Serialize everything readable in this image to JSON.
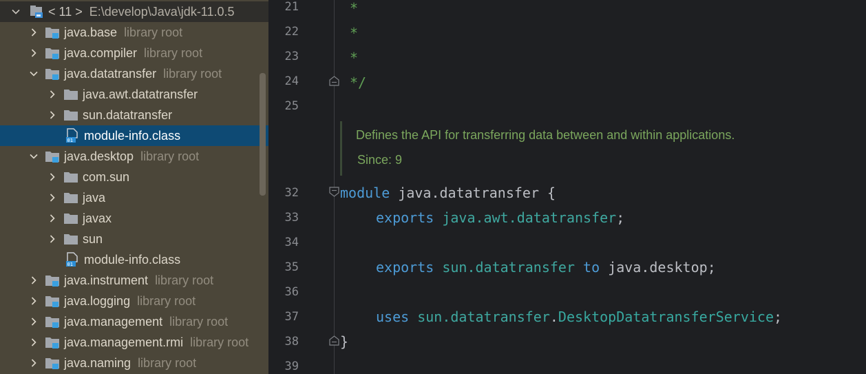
{
  "tree": {
    "root": {
      "label": "< 11 >",
      "path": "E:\\develop\\Java\\jdk-11.0.5"
    },
    "items": [
      {
        "label": "java.base",
        "hint": "library root"
      },
      {
        "label": "java.compiler",
        "hint": "library root"
      },
      {
        "label": "java.datatransfer",
        "hint": "library root"
      },
      {
        "label": "java.awt.datatransfer"
      },
      {
        "label": "sun.datatransfer"
      },
      {
        "label": "module-info.class"
      },
      {
        "label": "java.desktop",
        "hint": "library root"
      },
      {
        "label": "com.sun"
      },
      {
        "label": "java"
      },
      {
        "label": "javax"
      },
      {
        "label": "sun"
      },
      {
        "label": "module-info.class"
      },
      {
        "label": "java.instrument",
        "hint": "library root"
      },
      {
        "label": "java.logging",
        "hint": "library root"
      },
      {
        "label": "java.management",
        "hint": "library root"
      },
      {
        "label": "java.management.rmi",
        "hint": "library root"
      },
      {
        "label": "java.naming",
        "hint": "library root"
      }
    ]
  },
  "editor": {
    "line_numbers": [
      "21",
      "22",
      "23",
      "24",
      "25",
      "32",
      "33",
      "34",
      "35",
      "36",
      "37",
      "38",
      "39"
    ],
    "code": {
      "l21": "*",
      "l22": "*",
      "l23": "*",
      "l24": "*/",
      "l32_kw": "module",
      "l32_rest": " java.datatransfer {",
      "l33_kw": "exports",
      "l33_pkg": "java.awt.datatransfer",
      "l33_end": ";",
      "l35_kw": "exports",
      "l35_pkg": "sun.datatransfer",
      "l35_to": "to",
      "l35_mod": "java.desktop",
      "l35_end": ";",
      "l37_kw": "uses",
      "l37_pkg": "sun.datatransfer",
      "l37_dot": ".",
      "l37_cls": "DesktopDatatransferService",
      "l37_end": ";",
      "l38": "}"
    },
    "doc": {
      "text": "Defines the API for transferring data between and within applications.",
      "since": "Since: 9"
    }
  }
}
